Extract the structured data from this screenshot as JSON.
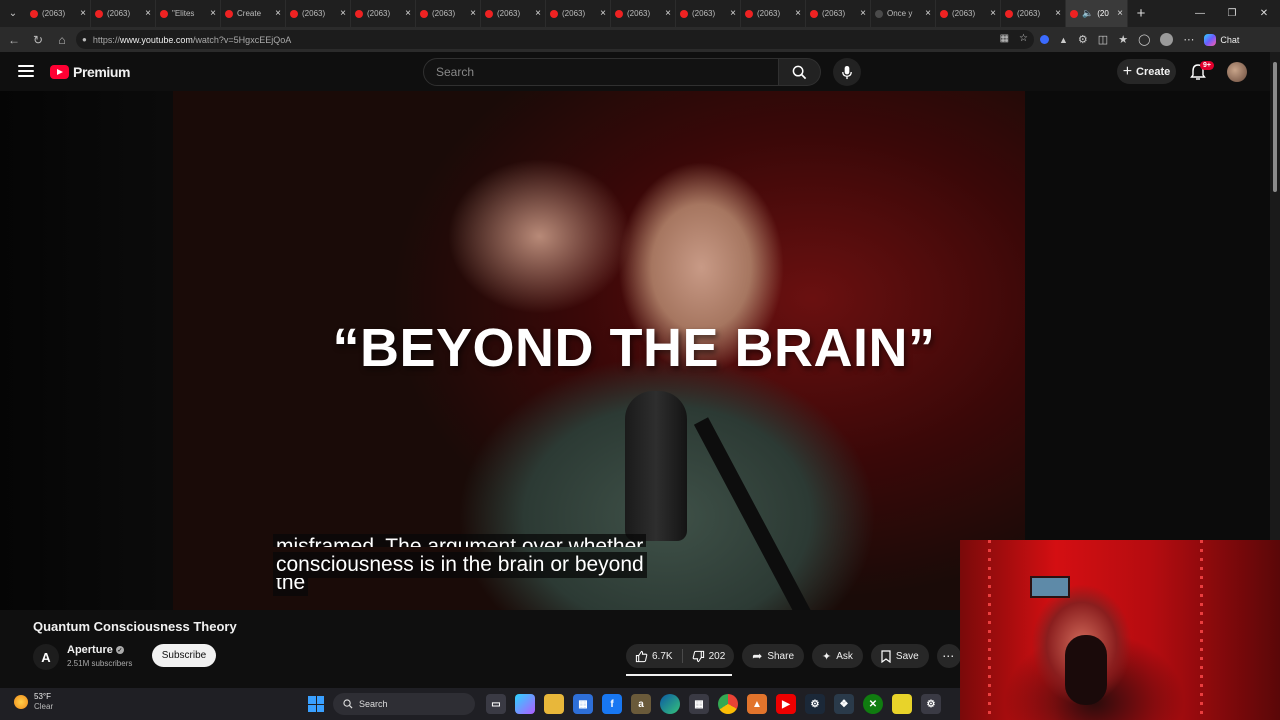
{
  "browser": {
    "tabs": [
      {
        "label": "(2063)",
        "fav": "youtube"
      },
      {
        "label": "(2063)",
        "fav": "youtube"
      },
      {
        "label": "\"Elites",
        "fav": "youtube"
      },
      {
        "label": "Create",
        "fav": "youtube"
      },
      {
        "label": "(2063)",
        "fav": "youtube"
      },
      {
        "label": "(2063)",
        "fav": "youtube"
      },
      {
        "label": "(2063)",
        "fav": "youtube"
      },
      {
        "label": "(2063)",
        "fav": "youtube"
      },
      {
        "label": "(2063)",
        "fav": "youtube"
      },
      {
        "label": "(2063)",
        "fav": "youtube"
      },
      {
        "label": "(2063)",
        "fav": "youtube"
      },
      {
        "label": "(2063)",
        "fav": "youtube"
      },
      {
        "label": "(2063)",
        "fav": "youtube"
      },
      {
        "label": "Once y",
        "fav": "dark"
      },
      {
        "label": "(2063)",
        "fav": "youtube"
      },
      {
        "label": "(2063)",
        "fav": "youtube"
      }
    ],
    "active_tab_label": "(20",
    "url_prefix": "https://",
    "url_host": "www.youtube.com",
    "url_path": "/watch?v=5HgxcEEjQoA",
    "copilot_label": "Chat"
  },
  "youtube": {
    "logo_text": "Premium",
    "search_placeholder": "Search",
    "create_label": "Create",
    "notification_badge": "9+"
  },
  "video": {
    "overlay_title": "“BEYOND THE BRAIN”",
    "caption_line_1": "misframed. The argument over whether",
    "caption_line_2": "consciousness is in the brain or beyond",
    "caption_line_3": "the",
    "title": "Quantum Consciousness Theory"
  },
  "channel": {
    "name": "Aperture",
    "avatar_letter": "A",
    "subscribers": "2.51M subscribers",
    "subscribe_label": "Subscribe"
  },
  "actions": {
    "likes": "6.7K",
    "dislikes": "202",
    "share": "Share",
    "ask": "Ask",
    "save": "Save"
  },
  "taskbar": {
    "temperature": "53°F",
    "condition": "Clear",
    "search_label": "Search"
  },
  "colors": {
    "youtube_red": "#ff0033",
    "subscribe_bg": "#f1f1f1"
  }
}
